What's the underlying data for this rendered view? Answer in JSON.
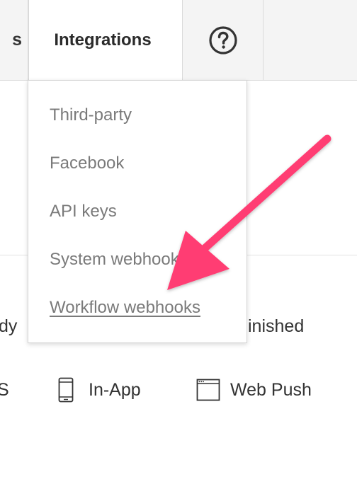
{
  "nav": {
    "prev_tab_fragment": "s",
    "active_tab": "Integrations",
    "help_icon": "question-circle-icon"
  },
  "dropdown": {
    "items": [
      {
        "label": "Third-party"
      },
      {
        "label": "Facebook"
      },
      {
        "label": "API keys"
      },
      {
        "label": "System webhooks"
      },
      {
        "label": "Workflow webhooks",
        "active": true
      }
    ]
  },
  "background": {
    "status_left_fragment": "dy",
    "status_right_fragment": "inished",
    "channels": {
      "left_fragment": "S",
      "in_app": "In-App",
      "web_push": "Web Push",
      "in_app_icon": "mobile-phone-icon",
      "web_push_icon": "browser-window-icon"
    }
  },
  "annotation": {
    "arrow_color": "#ff3e73"
  }
}
